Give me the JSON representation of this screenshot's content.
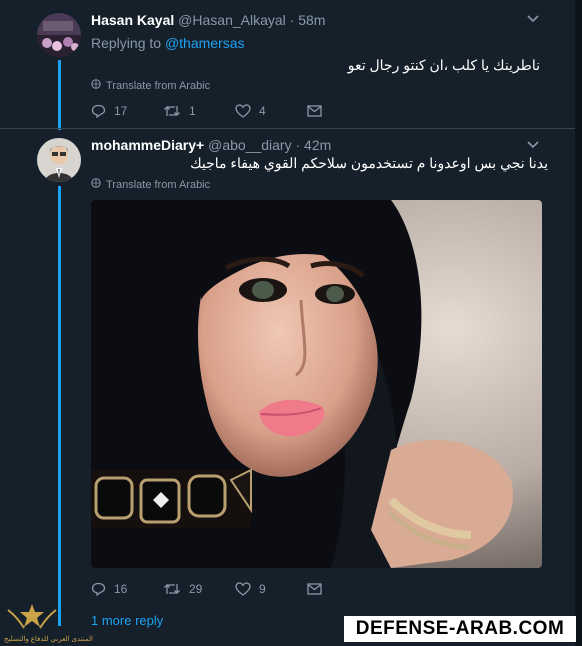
{
  "tweet1": {
    "name": "Hasan Kayal",
    "handle": "@Hasan_Alkayal",
    "time": "· 58m",
    "replying_prefix": "Replying to",
    "replying_handle": "@thamersas",
    "text": "ناطرينك يا كلب ،ان كنتو رجال تعو",
    "translate": "Translate from Arabic",
    "replies": "17",
    "retweets": "1",
    "likes": "4"
  },
  "tweet2": {
    "name": "mohammeDiary+",
    "handle": "@abo__diary",
    "time": "· 42m",
    "text": "يدنا نجي بس اوعدونا م تستخدمون سلاحكم القوي هيفاء ماجيك",
    "translate": "Translate from Arabic",
    "replies": "16",
    "retweets": "29",
    "likes": "9"
  },
  "more_reply": "1 more reply",
  "watermark": "DEFENSE-ARAB.COM",
  "logo_caption": "المنتدى العربي للدفاع والتسليح",
  "icons": [
    "chevron-down-icon",
    "reply-icon",
    "retweet-icon",
    "like-icon",
    "message-icon",
    "globe-icon"
  ],
  "colors": {
    "background": "#15202b",
    "accent": "#1da1f2",
    "muted": "#8899a6"
  }
}
